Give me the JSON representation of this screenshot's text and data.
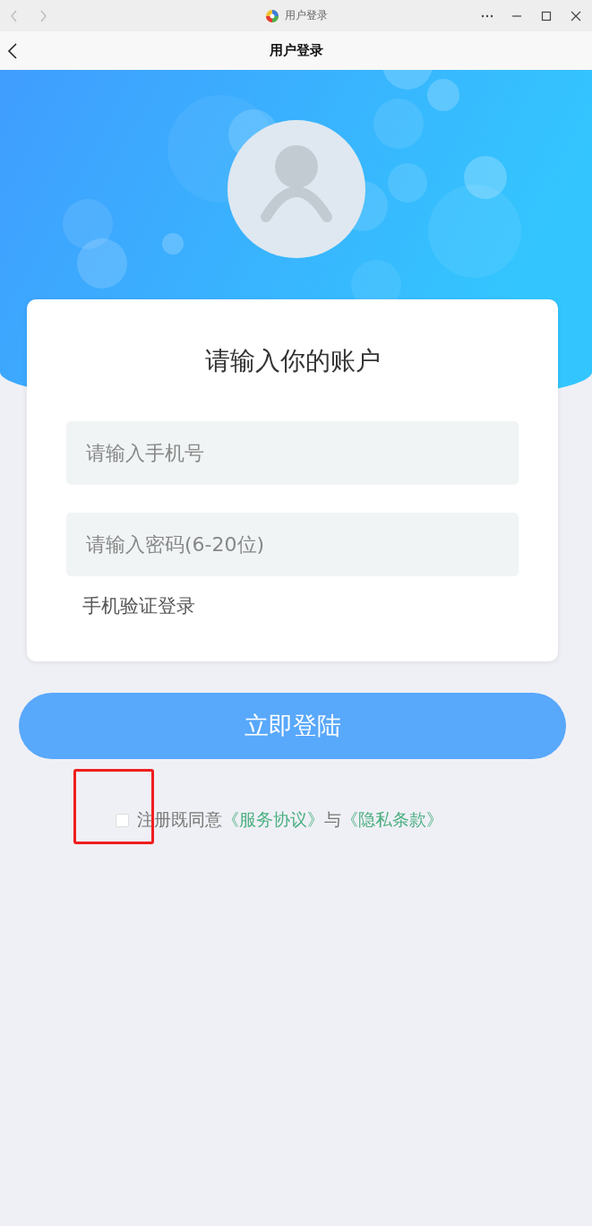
{
  "window": {
    "title": "用户登录"
  },
  "nav": {
    "title": "用户登录"
  },
  "login": {
    "heading": "请输入你的账户",
    "fields": [
      {
        "placeholder": "请输入手机号"
      },
      {
        "placeholder": "请输入密码(6-20位)"
      }
    ],
    "sms_link": "手机验证登录",
    "submit": "立即登陆"
  },
  "agreement": {
    "checked": false,
    "lead": "注册既同意",
    "terms_link": "《服务协议》",
    "joiner": "与",
    "privacy_link": "《隐私条款》"
  }
}
